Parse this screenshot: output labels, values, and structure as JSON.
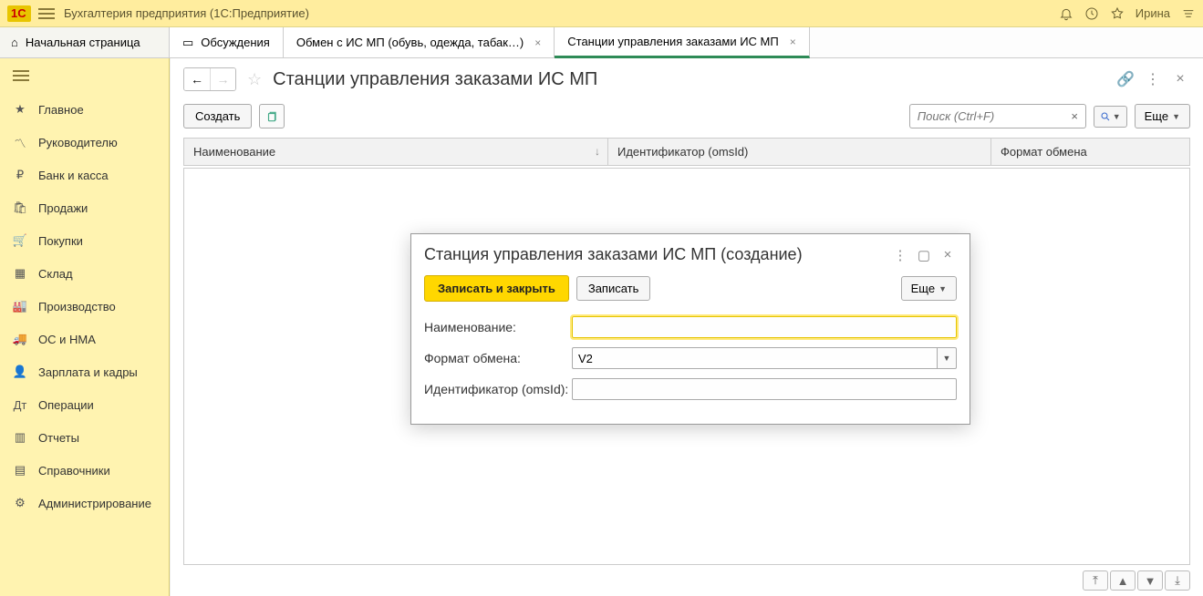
{
  "app": {
    "title": "Бухгалтерия предприятия  (1С:Предприятие)",
    "user": "Ирина"
  },
  "tabs": {
    "home": "Начальная страница",
    "items": [
      {
        "label": "Обсуждения"
      },
      {
        "label": "Обмен с ИС МП (обувь, одежда, табак…)"
      },
      {
        "label": "Станции управления заказами ИС МП"
      }
    ]
  },
  "sidebar": {
    "items": [
      {
        "label": "Главное"
      },
      {
        "label": "Руководителю"
      },
      {
        "label": "Банк и касса"
      },
      {
        "label": "Продажи"
      },
      {
        "label": "Покупки"
      },
      {
        "label": "Склад"
      },
      {
        "label": "Производство"
      },
      {
        "label": "ОС и НМА"
      },
      {
        "label": "Зарплата и кадры"
      },
      {
        "label": "Операции"
      },
      {
        "label": "Отчеты"
      },
      {
        "label": "Справочники"
      },
      {
        "label": "Администрирование"
      }
    ]
  },
  "page": {
    "title": "Станции управления заказами ИС МП",
    "create": "Создать",
    "search_placeholder": "Поиск (Ctrl+F)",
    "more": "Еще",
    "columns": {
      "name": "Наименование",
      "omsid": "Идентификатор (omsId)",
      "format": "Формат обмена"
    }
  },
  "modal": {
    "title": "Станция управления заказами ИС МП (создание)",
    "save_close": "Записать и закрыть",
    "save": "Записать",
    "more": "Еще",
    "fields": {
      "name_label": "Наименование:",
      "name_value": "",
      "format_label": "Формат обмена:",
      "format_value": "V2",
      "omsid_label": "Идентификатор (omsId):",
      "omsid_value": ""
    }
  }
}
